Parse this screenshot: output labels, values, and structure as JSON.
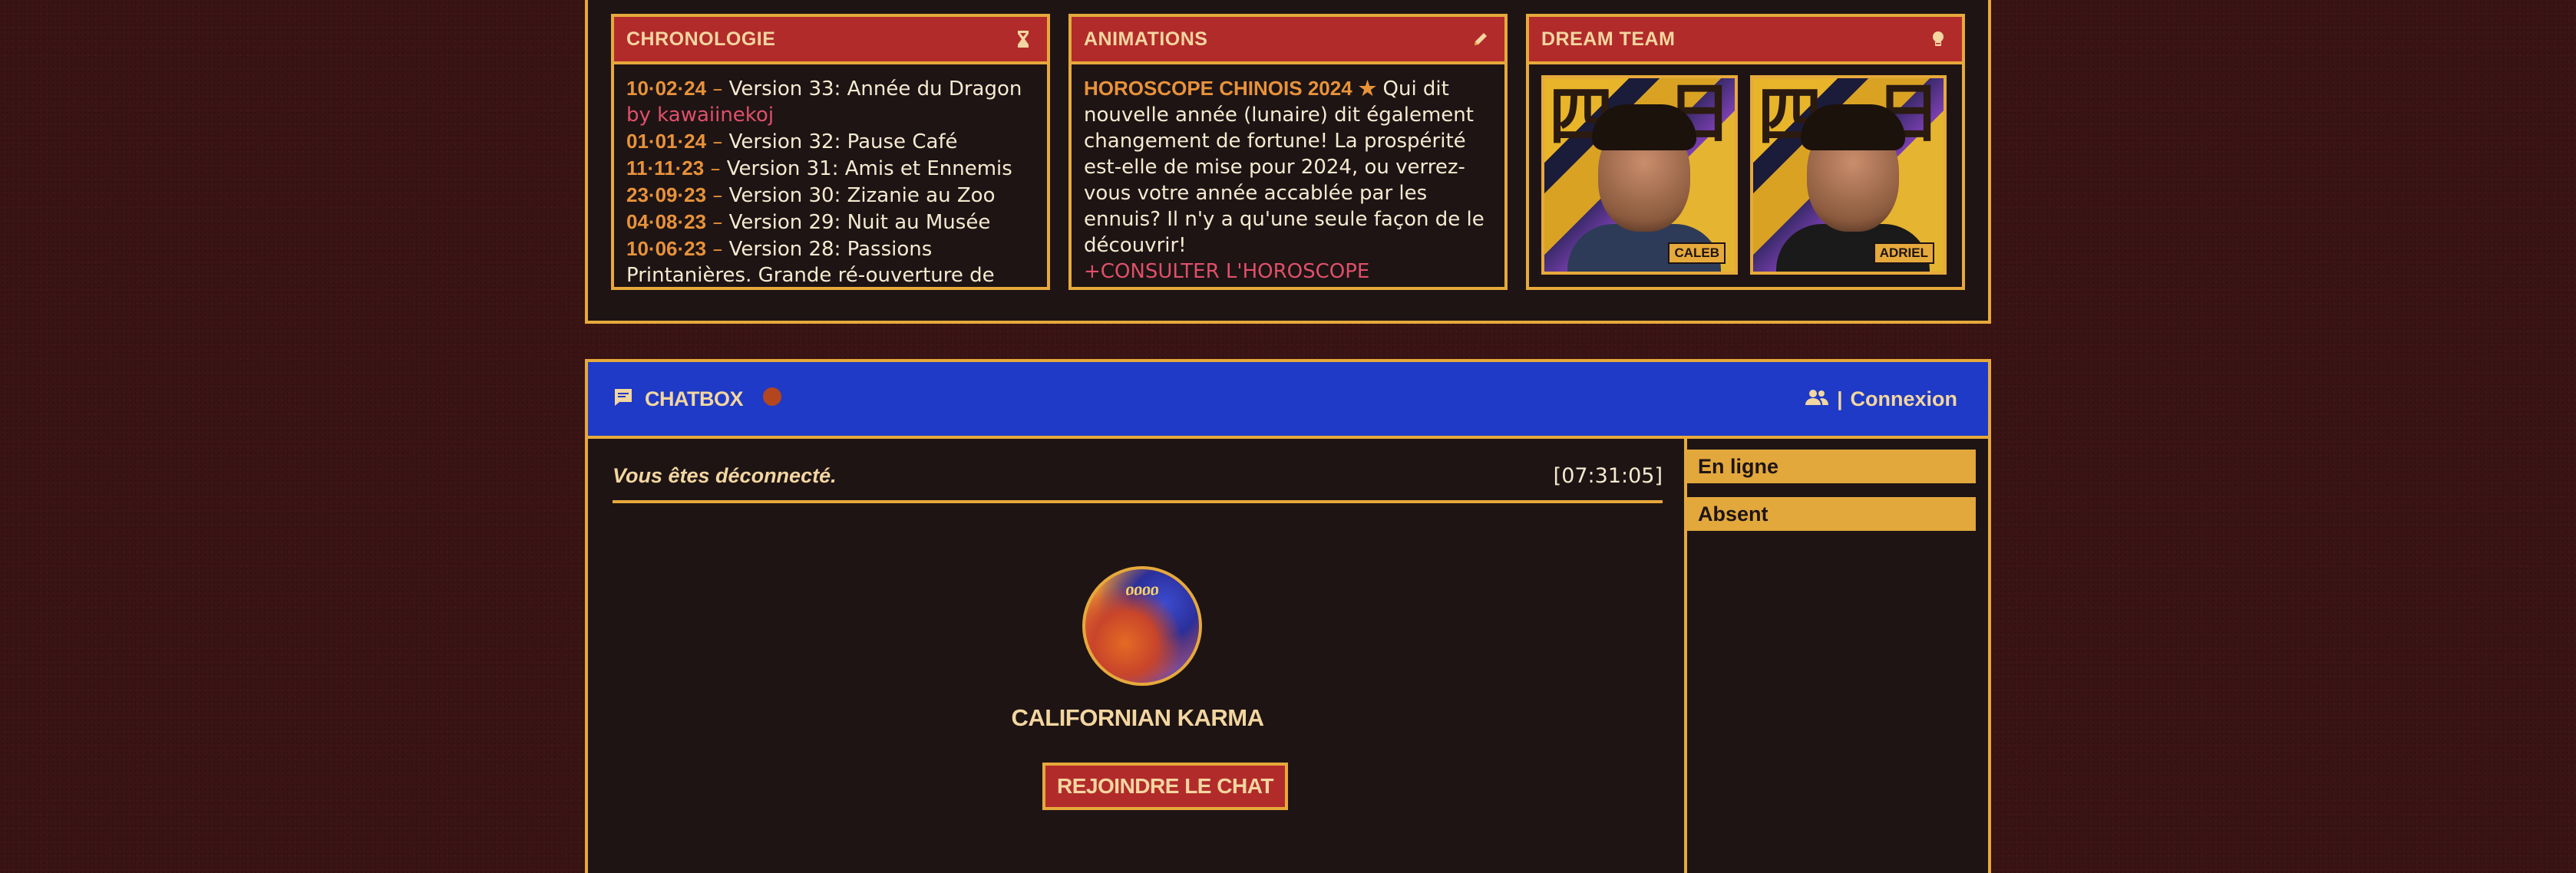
{
  "widgets": {
    "chronologie": {
      "title": "CHRONOLOGIE",
      "icon": "hourglass-icon",
      "entries": [
        {
          "date": "10·02·24",
          "sep": " – ",
          "text": "Version 33: Année du Dragon"
        },
        {
          "by": "by kawaiinekoj"
        },
        {
          "date": "01·01·24",
          "sep": " – ",
          "text": "Version 32: Pause Café"
        },
        {
          "date": "11·11·23",
          "sep": " – ",
          "text": "Version 31: Amis et Ennemis"
        },
        {
          "date": "23·09·23",
          "sep": " – ",
          "text": "Version 30: Zizanie au Zoo"
        },
        {
          "date": "04·08·23",
          "sep": " – ",
          "text": "Version 29: Nuit au Musée"
        },
        {
          "date": "10·06·23",
          "sep": " – ",
          "text": "Version 28: Passions Printanières. Grande ré-ouverture de"
        }
      ]
    },
    "animations": {
      "title": "ANIMATIONS",
      "icon": "pencil-icon",
      "headline": "HOROSCOPE CHINOIS 2024",
      "star": "★",
      "body": "Qui dit nouvelle année (lunaire) dit également changement de fortune! La prospérité est-elle de mise pour 2024, ou verrez-vous votre année accablée par les ennuis? Il n'y a qu'une seule façon de le découvrir!",
      "link": "+CONSULTER L'HOROSCOPE"
    },
    "dream_team": {
      "title": "DREAM TEAM",
      "icon": "lightbulb-icon",
      "members": [
        {
          "name": "CALEB",
          "glyph_left": "四",
          "glyph_right": "日"
        },
        {
          "name": "ADRIEL",
          "glyph_left": "四",
          "glyph_right": "日"
        }
      ]
    }
  },
  "chatbox": {
    "title": "CHATBOX",
    "users_icon": "users-icon",
    "connexion_sep": "|",
    "connexion_label": "Connexion",
    "status_text": "Vous êtes déconnecté.",
    "time": "[07:31:05]",
    "avatar_text": "ዐዐዐዐ",
    "username": "CALIFORNIAN KARMA",
    "join_label": "REJOINDRE LE CHAT",
    "groups": [
      "En ligne",
      "Absent"
    ],
    "accent_colors": {
      "gold": "#e6a93b",
      "red": "#b22b2b",
      "blue": "#1e3ac6",
      "orange": "#e8923a",
      "pink": "#e0506a"
    }
  }
}
